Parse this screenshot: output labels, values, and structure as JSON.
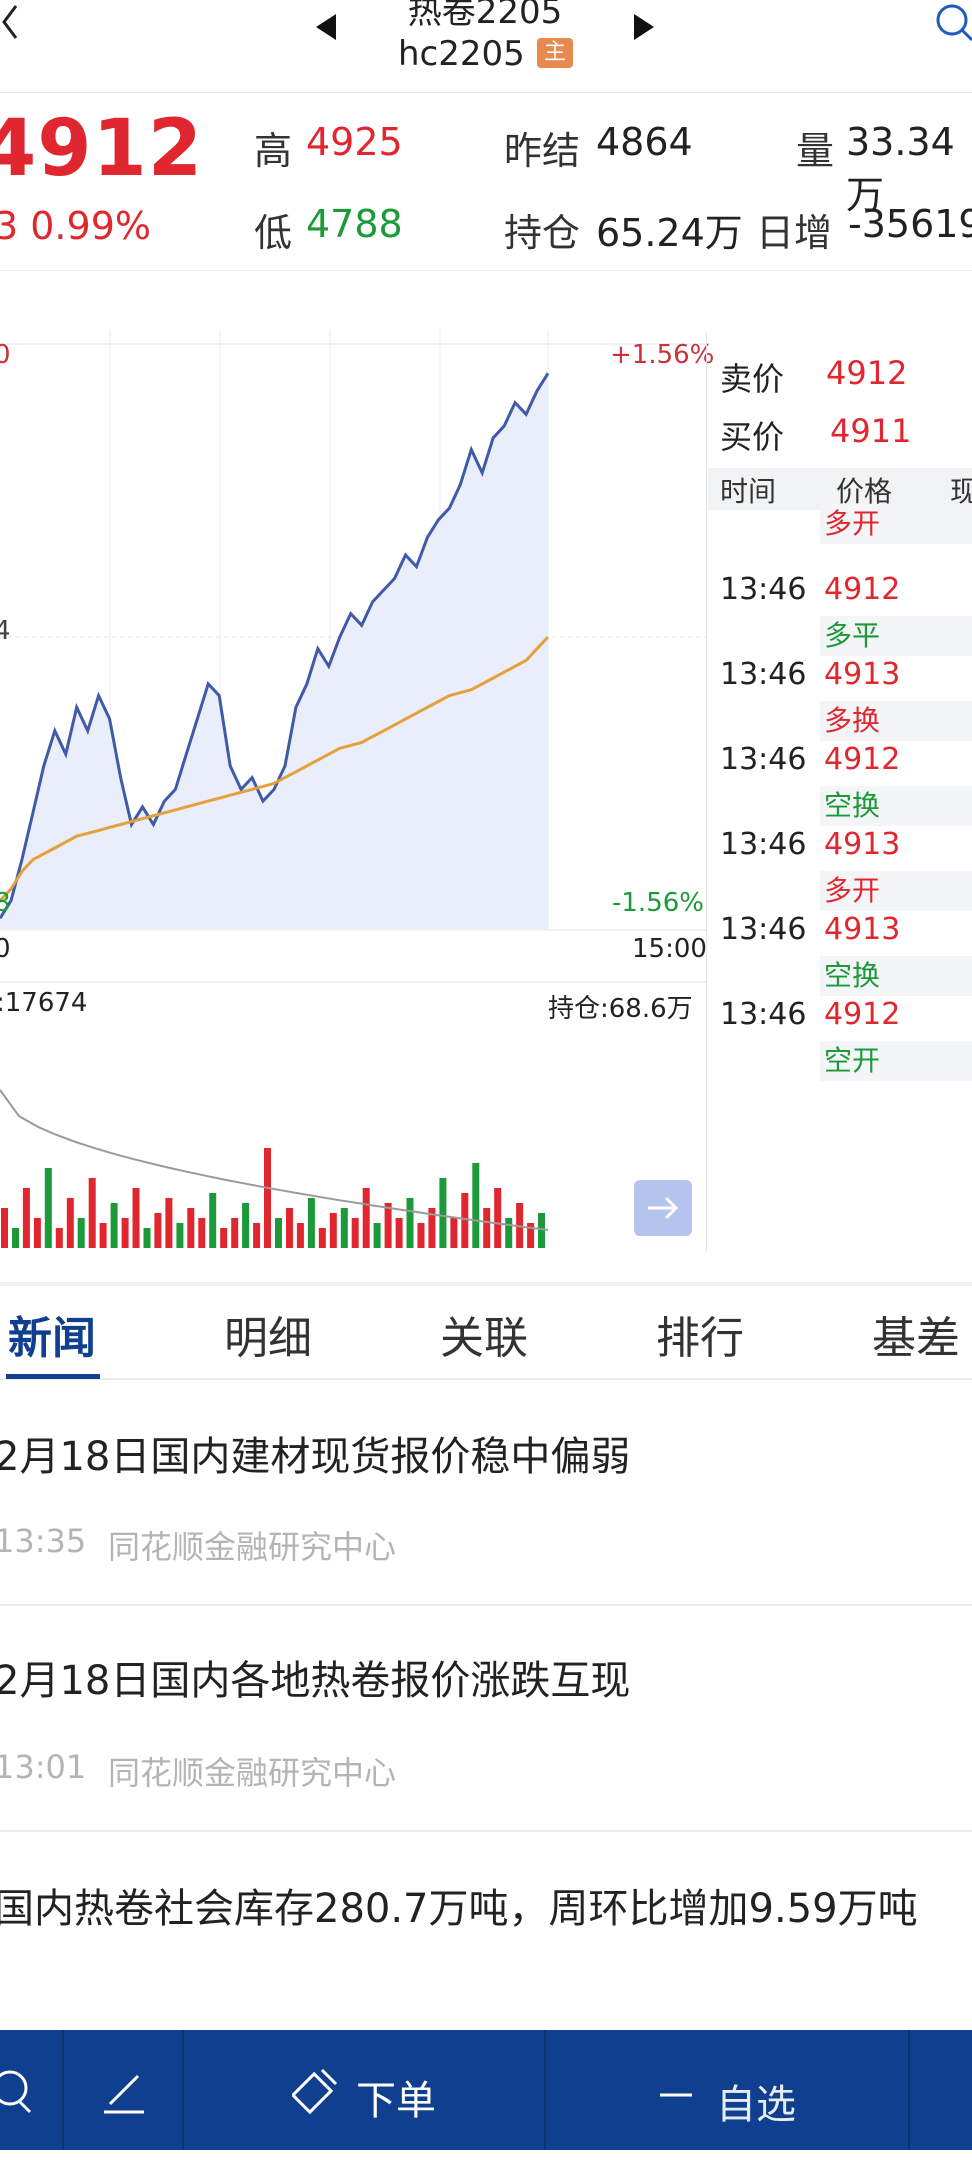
{
  "header": {
    "title": "热卷2205",
    "code": "hc2205",
    "badge": "主",
    "icons": [
      "back-chevron-icon",
      "prev-contract-icon",
      "next-contract-icon",
      "search-icon"
    ]
  },
  "quote": {
    "last_price": "4912",
    "change": "3 0.99%",
    "high_label": "高",
    "high_value": "4925",
    "low_label": "低",
    "low_value": "4788",
    "prev_settle_label": "昨结",
    "prev_settle_value": "4864",
    "open_interest_label": "持仓",
    "open_interest_value": "65.24万",
    "volume_label": "量",
    "volume_value": "33.34万",
    "daily_change_label": "日增",
    "daily_change_value": "-35619"
  },
  "chart_data": {
    "type": "line",
    "pct_top": "+1.56%",
    "pct_bottom": "-1.56%",
    "left_top": "0",
    "left_mid": "4",
    "left_bottom": "8",
    "time_start": "0",
    "time_end": "15:00",
    "volume_label": ":17674",
    "open_interest_label": "持仓:68.6万",
    "series": [
      {
        "values": [
          0.98,
          0.95,
          0.88,
          0.8,
          0.72,
          0.66,
          0.7,
          0.62,
          0.66,
          0.6,
          0.64,
          0.74,
          0.82,
          0.79,
          0.82,
          0.78,
          0.76,
          0.7,
          0.64,
          0.58,
          0.6,
          0.72,
          0.76,
          0.74,
          0.78,
          0.76,
          0.72,
          0.62,
          0.58,
          0.52,
          0.55,
          0.5,
          0.46,
          0.48,
          0.44,
          0.42,
          0.4,
          0.36,
          0.38,
          0.33,
          0.3,
          0.28,
          0.24,
          0.18,
          0.22,
          0.16,
          0.14,
          0.1,
          0.12,
          0.08,
          0.05
        ]
      },
      {
        "values": [
          0.95,
          0.93,
          0.9,
          0.88,
          0.87,
          0.86,
          0.85,
          0.84,
          0.835,
          0.83,
          0.825,
          0.82,
          0.815,
          0.81,
          0.805,
          0.8,
          0.795,
          0.79,
          0.785,
          0.78,
          0.775,
          0.77,
          0.765,
          0.76,
          0.755,
          0.75,
          0.74,
          0.73,
          0.72,
          0.71,
          0.7,
          0.69,
          0.685,
          0.68,
          0.67,
          0.66,
          0.65,
          0.64,
          0.63,
          0.62,
          0.61,
          0.6,
          0.595,
          0.59,
          0.58,
          0.57,
          0.56,
          0.55,
          0.54,
          0.52,
          0.5
        ]
      }
    ],
    "volume_bars": [
      0.4,
      0.2,
      0.6,
      0.3,
      0.8,
      0.2,
      0.5,
      0.3,
      0.7,
      0.25,
      0.45,
      0.3,
      0.6,
      0.2,
      0.35,
      0.5,
      0.25,
      0.4,
      0.3,
      0.55,
      0.2,
      0.3,
      0.45,
      0.25,
      1.0,
      0.3,
      0.4,
      0.25,
      0.5,
      0.2,
      0.35,
      0.4,
      0.3,
      0.6,
      0.25,
      0.45,
      0.3,
      0.5,
      0.25,
      0.4,
      0.7,
      0.3,
      0.55,
      0.85,
      0.4,
      0.6,
      0.3,
      0.45,
      0.25,
      0.35
    ]
  },
  "order_book": {
    "sell_label": "卖价",
    "sell_value": "4912",
    "buy_label": "买价",
    "buy_value": "4911",
    "col_time": "时间",
    "col_price": "价格",
    "col_cur": "现",
    "top_tag": "多开",
    "rows": [
      {
        "time": "13:46",
        "price": "4912",
        "tag": "多平",
        "tag_color": "green"
      },
      {
        "time": "13:46",
        "price": "4913",
        "tag": "多换",
        "tag_color": "red"
      },
      {
        "time": "13:46",
        "price": "4912",
        "tag": "空换",
        "tag_color": "green"
      },
      {
        "time": "13:46",
        "price": "4913",
        "tag": "多开",
        "tag_color": "red"
      },
      {
        "time": "13:46",
        "price": "4913",
        "tag": "空换",
        "tag_color": "green"
      },
      {
        "time": "13:46",
        "price": "4912",
        "tag": "空开",
        "tag_color": "green"
      }
    ]
  },
  "tabs": [
    "新闻",
    "明细",
    "关联",
    "排行",
    "基差"
  ],
  "news": [
    {
      "title": "2月18日国内建材现货报价稳中偏弱",
      "time": "13:35",
      "source": "同花顺金融研究中心"
    },
    {
      "title": "2月18日国内各地热卷报价涨跌互现",
      "time": "13:01",
      "source": "同花顺金融研究中心"
    },
    {
      "title": "国内热卷社会库存280.7万吨，周环比增加9.59万吨"
    }
  ],
  "bottom_bar": {
    "order_label": "下单",
    "watch_label": "自选",
    "icons": [
      "search-icon",
      "pen-icon",
      "order-icon",
      "minus-icon"
    ]
  },
  "colors": {
    "brand": "#0f3f8e",
    "up": "#e0262f",
    "down": "#1c9a3a",
    "price_line": "#3f5aa8",
    "avg_line": "#e3a03d"
  }
}
